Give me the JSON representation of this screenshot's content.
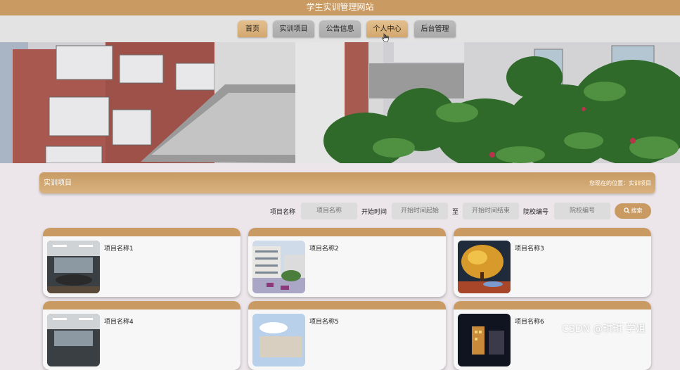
{
  "header": {
    "site_title": "学生实训管理网站"
  },
  "nav": {
    "items": [
      {
        "label": "首页",
        "active": true
      },
      {
        "label": "实训项目",
        "active": false
      },
      {
        "label": "公告信息",
        "active": false
      },
      {
        "label": "个人中心",
        "active": true
      },
      {
        "label": "后台管理",
        "active": false
      }
    ]
  },
  "section": {
    "title": "实训项目",
    "location": "您现在的位置：实训项目"
  },
  "filters": {
    "project_name_label": "项目名称",
    "project_name_placeholder": "项目名称",
    "start_time_label": "开始时间",
    "start_from_placeholder": "开始时间起始",
    "range_sep": "至",
    "start_to_placeholder": "开始时间结束",
    "school_code_label": "院校编号",
    "school_code_placeholder": "院校编号",
    "search_label": "搜索"
  },
  "cards": [
    {
      "name": "项目名称1",
      "icon": "meeting-room-photo"
    },
    {
      "name": "项目名称2",
      "icon": "campus-courtyard-photo"
    },
    {
      "name": "项目名称3",
      "icon": "autumn-tree-photo"
    },
    {
      "name": "项目名称4",
      "icon": "meeting-room-photo"
    },
    {
      "name": "项目名称5",
      "icon": "campus-building-photo"
    },
    {
      "name": "项目名称6",
      "icon": "night-building-photo"
    }
  ],
  "watermark": "CSDN @琪琪 学姐",
  "colors": {
    "accent": "#c99a62",
    "nav_active": "#d8b07a",
    "nav_default": "#b3b3b3",
    "page_bg": "#ece6ea"
  }
}
